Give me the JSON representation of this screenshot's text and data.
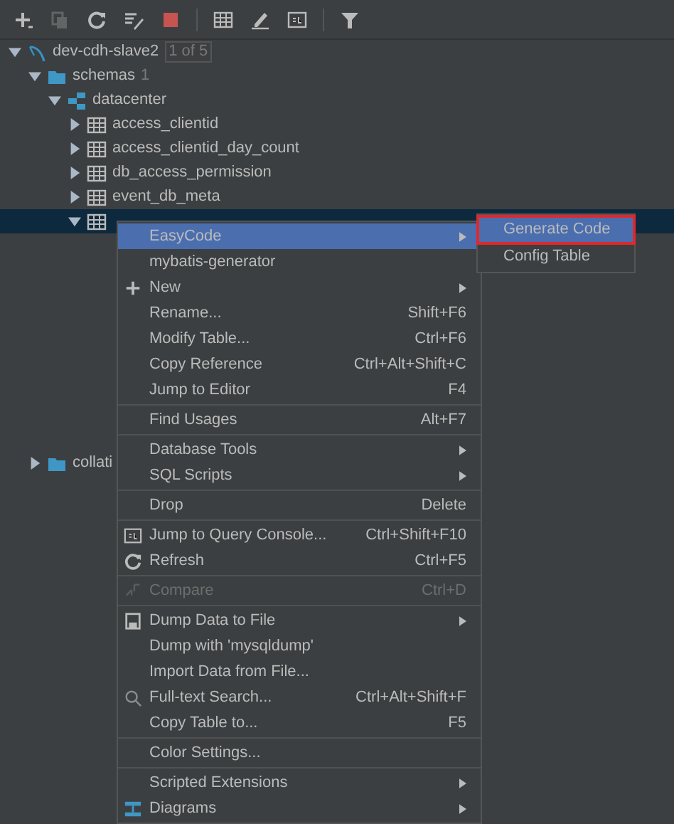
{
  "toolbar": [
    {
      "kind": "button",
      "disabled": false
    },
    {
      "kind": "button",
      "disabled": true
    },
    {
      "kind": "button",
      "disabled": false
    },
    {
      "kind": "button",
      "disabled": false
    },
    {
      "kind": "button",
      "disabled": false
    },
    {
      "kind": "separator"
    },
    {
      "kind": "button",
      "disabled": false
    },
    {
      "kind": "button",
      "disabled": false
    },
    {
      "kind": "button",
      "disabled": false
    },
    {
      "kind": "separator"
    },
    {
      "kind": "button",
      "disabled": false
    }
  ],
  "tree": [
    {
      "label": "dev-cdh-slave2",
      "badge": "1 of 5",
      "kind": "datasource",
      "expanded": true,
      "selected": false,
      "children": [
        {
          "label": "schemas",
          "badge": "1",
          "kind": "folder",
          "expanded": true,
          "selected": false,
          "children": [
            {
              "label": "datacenter",
              "kind": "schema",
              "expanded": true,
              "selected": false,
              "children": [
                {
                  "label": "access_clientid",
                  "kind": "table",
                  "expanded": false,
                  "selected": false
                },
                {
                  "label": "access_clientid_day_count",
                  "kind": "table",
                  "expanded": false,
                  "selected": false
                },
                {
                  "label": "db_access_permission",
                  "kind": "table",
                  "expanded": false,
                  "selected": false
                },
                {
                  "label": "event_db_meta",
                  "kind": "table",
                  "expanded": false,
                  "selected": false
                },
                {
                  "kind": "table",
                  "expanded": true,
                  "selected": true
                }
              ]
            }
          ]
        },
        {
          "label": "collati",
          "kind": "folder",
          "expanded": false,
          "selected": false
        }
      ]
    }
  ],
  "context_menu": [
    {
      "kind": "item",
      "label": "EasyCode",
      "submenu": true,
      "selected": true,
      "disabled": false
    },
    {
      "kind": "item",
      "label": "mybatis-generator",
      "submenu": false,
      "selected": false,
      "disabled": false
    },
    {
      "kind": "item",
      "label": "New",
      "submenu": true,
      "selected": false,
      "disabled": false
    },
    {
      "kind": "item",
      "label": "Rename...",
      "shortcut": "Shift+F6",
      "submenu": false,
      "selected": false,
      "disabled": false
    },
    {
      "kind": "item",
      "label": "Modify Table...",
      "shortcut": "Ctrl+F6",
      "submenu": false,
      "selected": false,
      "disabled": false
    },
    {
      "kind": "item",
      "label": "Copy Reference",
      "shortcut": "Ctrl+Alt+Shift+C",
      "submenu": false,
      "selected": false,
      "disabled": false
    },
    {
      "kind": "item",
      "label": "Jump to Editor",
      "shortcut": "F4",
      "submenu": false,
      "selected": false,
      "disabled": false
    },
    {
      "kind": "separator"
    },
    {
      "kind": "item",
      "label": "Find Usages",
      "shortcut": "Alt+F7",
      "submenu": false,
      "selected": false,
      "disabled": false
    },
    {
      "kind": "separator"
    },
    {
      "kind": "item",
      "label": "Database Tools",
      "submenu": true,
      "selected": false,
      "disabled": false
    },
    {
      "kind": "item",
      "label": "SQL Scripts",
      "submenu": true,
      "selected": false,
      "disabled": false
    },
    {
      "kind": "separator"
    },
    {
      "kind": "item",
      "label": "Drop",
      "shortcut": "Delete",
      "submenu": false,
      "selected": false,
      "disabled": false
    },
    {
      "kind": "separator"
    },
    {
      "kind": "item",
      "label": "Jump to Query Console...",
      "shortcut": "Ctrl+Shift+F10",
      "submenu": false,
      "selected": false,
      "disabled": false
    },
    {
      "kind": "item",
      "label": "Refresh",
      "shortcut": "Ctrl+F5",
      "submenu": false,
      "selected": false,
      "disabled": false
    },
    {
      "kind": "separator"
    },
    {
      "kind": "item",
      "label": "Compare",
      "shortcut": "Ctrl+D",
      "submenu": false,
      "selected": false,
      "disabled": true
    },
    {
      "kind": "separator"
    },
    {
      "kind": "item",
      "label": "Dump Data to File",
      "submenu": true,
      "selected": false,
      "disabled": false
    },
    {
      "kind": "item",
      "label": "Dump with 'mysqldump'",
      "submenu": false,
      "selected": false,
      "disabled": false
    },
    {
      "kind": "item",
      "label": "Import Data from File...",
      "submenu": false,
      "selected": false,
      "disabled": false
    },
    {
      "kind": "item",
      "label": "Full-text Search...",
      "shortcut": "Ctrl+Alt+Shift+F",
      "submenu": false,
      "selected": false,
      "disabled": false
    },
    {
      "kind": "item",
      "label": "Copy Table to...",
      "shortcut": "F5",
      "submenu": false,
      "selected": false,
      "disabled": false
    },
    {
      "kind": "separator"
    },
    {
      "kind": "item",
      "label": "Color Settings...",
      "submenu": false,
      "selected": false,
      "disabled": false
    },
    {
      "kind": "separator"
    },
    {
      "kind": "item",
      "label": "Scripted Extensions",
      "submenu": true,
      "selected": false,
      "disabled": false
    },
    {
      "kind": "item",
      "label": "Diagrams",
      "submenu": true,
      "selected": false,
      "disabled": false
    }
  ],
  "submenu": [
    {
      "label": "Generate Code",
      "selected": true,
      "highlighted": true
    },
    {
      "label": "Config Table",
      "selected": false,
      "highlighted": false
    }
  ]
}
